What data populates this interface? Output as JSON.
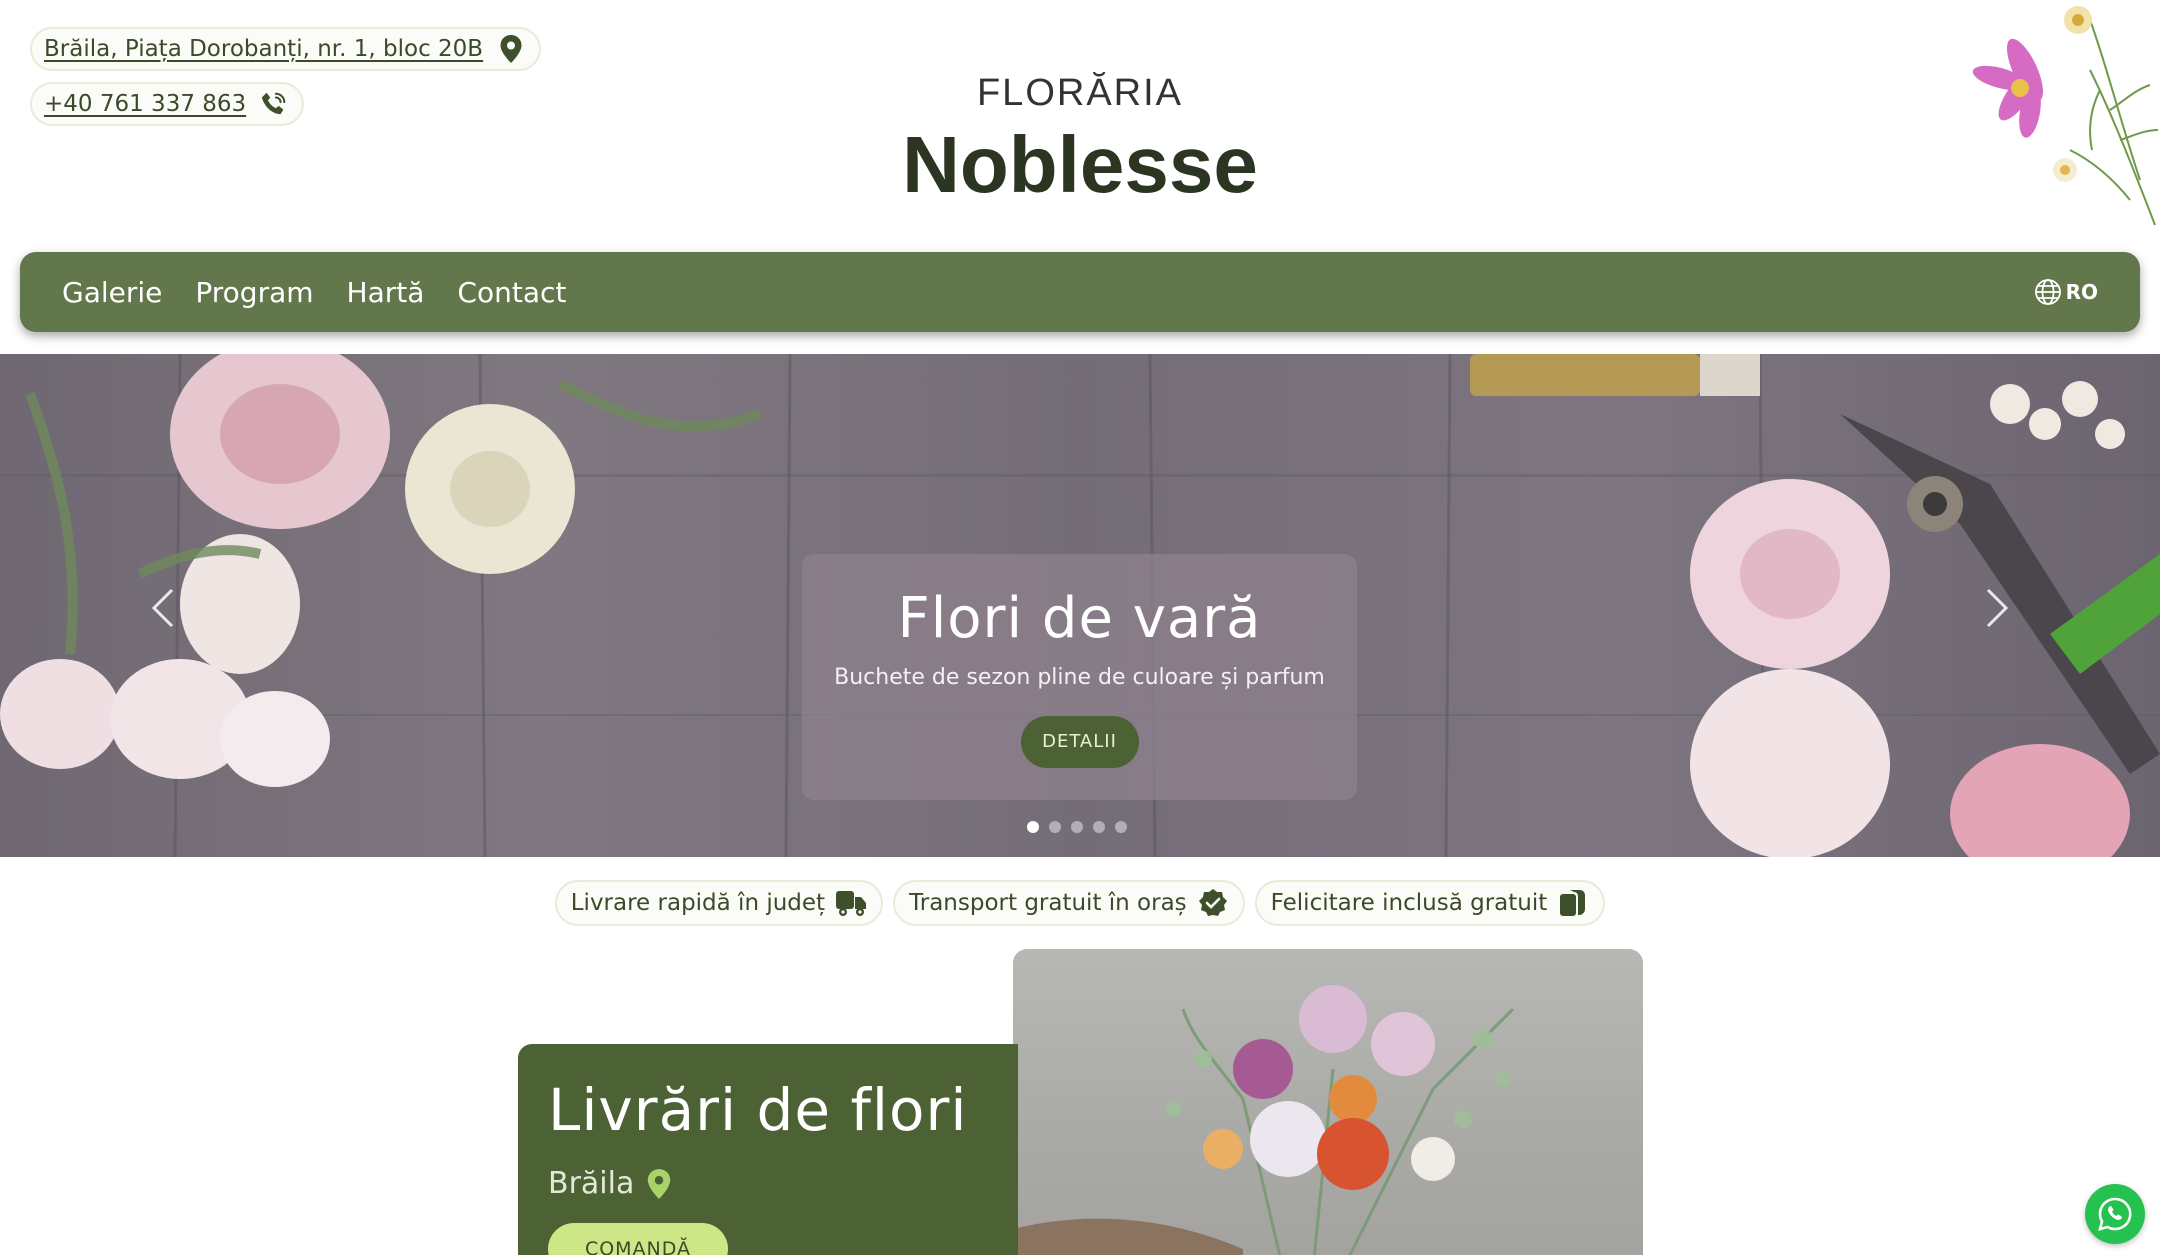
{
  "header": {
    "address": "Brăila, Piața Dorobanți, nr. 1, bloc 20B",
    "phone": "+40 761 337 863",
    "brand_small": "FLORĂRIA",
    "brand_name": "Noblesse"
  },
  "nav": {
    "items": [
      {
        "label": "Galerie"
      },
      {
        "label": "Program"
      },
      {
        "label": "Hartă"
      },
      {
        "label": "Contact"
      }
    ],
    "language": "RO"
  },
  "hero": {
    "title": "Flori de vară",
    "subtitle": "Buchete de sezon pline de culoare și parfum",
    "button_label": "DETALII",
    "slide_count": 5,
    "active_slide": 1
  },
  "features": [
    {
      "label": "Livrare rapidă în județ",
      "icon": "truck-icon"
    },
    {
      "label": "Transport gratuit în oraș",
      "icon": "check-badge-icon"
    },
    {
      "label": "Felicitare inclusă gratuit",
      "icon": "card-icon"
    }
  ],
  "delivery": {
    "title": "Livrări de flori",
    "city": "Brăila",
    "order_label": "COMANDĂ"
  },
  "colors": {
    "nav_green": "#62774b",
    "dark_green": "#4d6234",
    "accent_lime": "#cde686",
    "whatsapp_green": "#25c24f"
  }
}
